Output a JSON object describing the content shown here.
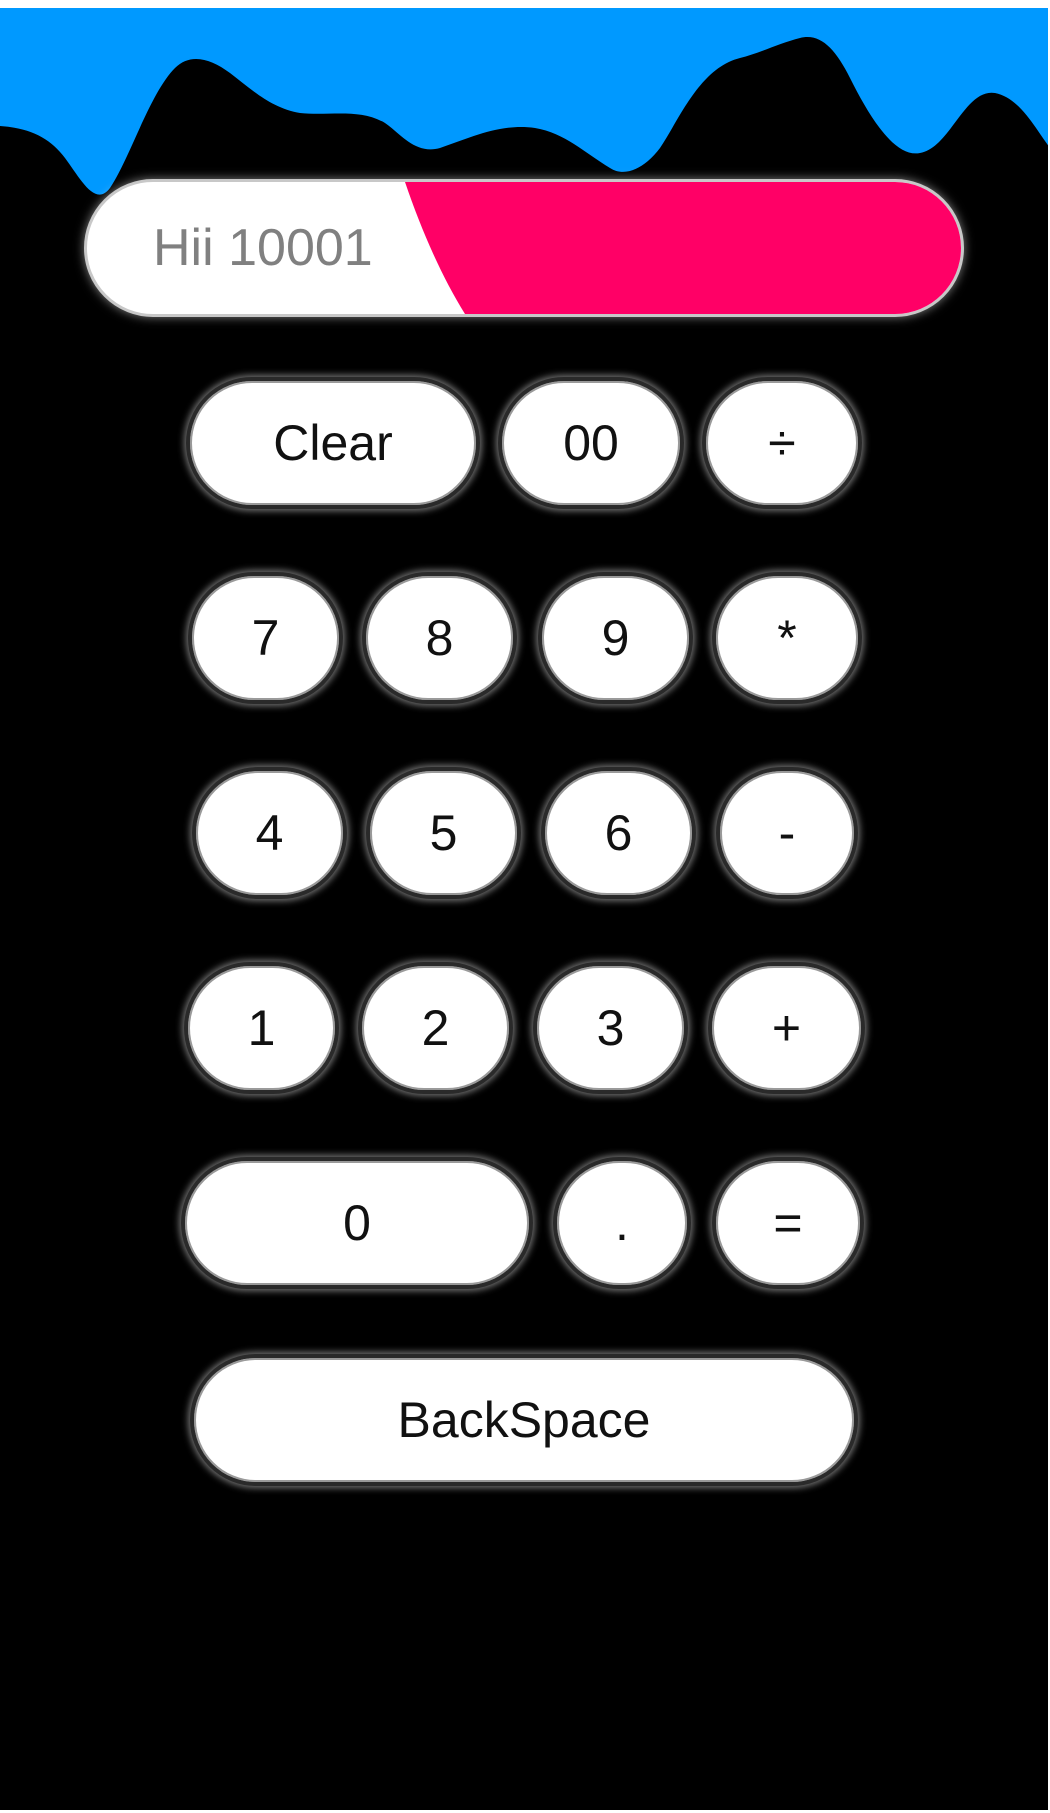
{
  "display": {
    "text": "Hii 10001"
  },
  "colors": {
    "wave": "#0099ff",
    "display_accent": "#ff0066",
    "background": "#000000",
    "key_face": "#ffffff"
  },
  "keys": {
    "clear": "Clear",
    "double_zero": "00",
    "divide": "÷",
    "seven": "7",
    "eight": "8",
    "nine": "9",
    "multiply": "*",
    "four": "4",
    "five": "5",
    "six": "6",
    "minus": "-",
    "one": "1",
    "two": "2",
    "three": "3",
    "plus": "+",
    "zero": "0",
    "decimal": ".",
    "equals": "=",
    "backspace": "BackSpace"
  }
}
